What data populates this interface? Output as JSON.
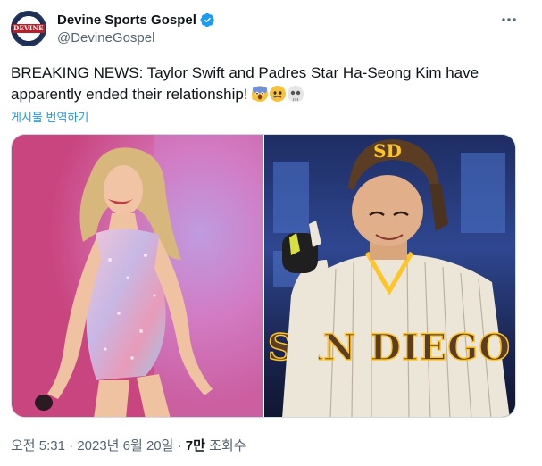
{
  "author": {
    "display_name": "Devine Sports Gospel",
    "handle": "@DevineGospel",
    "avatar_text": "DEVINE",
    "verified": true
  },
  "tweet": {
    "text": "BREAKING NEWS: Taylor Swift and Padres Star Ha-Seong Kim have apparently ended their relationship!",
    "emojis": [
      "face-screaming-in-fear",
      "face-holding-back-tears",
      "skull"
    ],
    "translate_label": "게시물 번역하기"
  },
  "media": {
    "images": [
      {
        "subject": "performer-in-sequined-bodysuit"
      },
      {
        "subject": "padres-player-pointing",
        "jersey_text": "SAN DIEGO",
        "cap_logo": "SD"
      }
    ]
  },
  "meta": {
    "time": "오전 5:31",
    "separator": "·",
    "date": "2023년 6월 20일",
    "views_count": "7만",
    "views_label": "조회수"
  },
  "colors": {
    "text_primary": "#0f1419",
    "text_secondary": "#536471",
    "link": "#1d9bf0",
    "verified": "#1d9bf0"
  }
}
